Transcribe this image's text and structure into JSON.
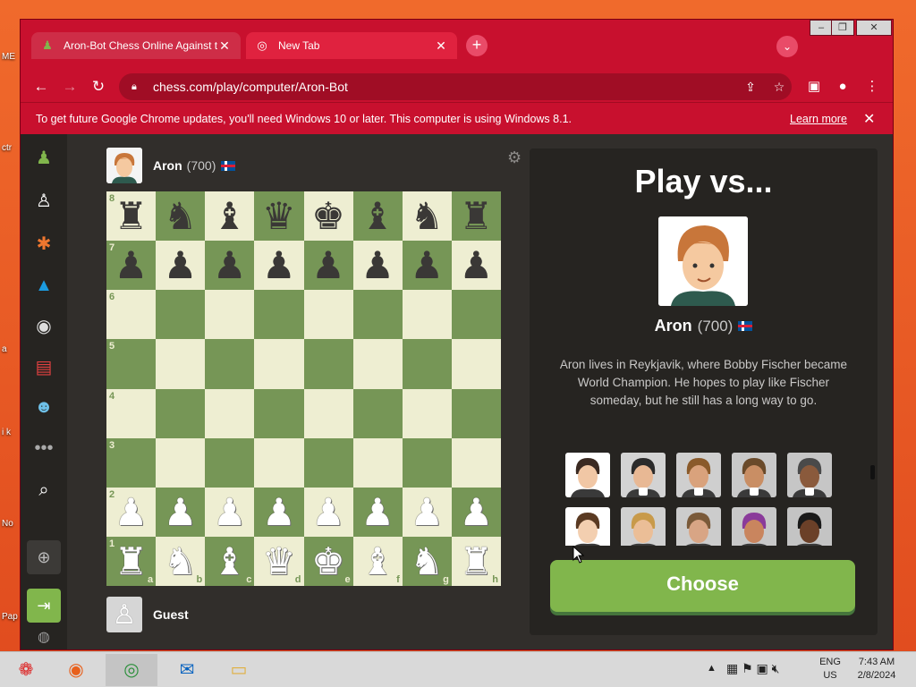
{
  "browser": {
    "tabs": [
      {
        "title": "Aron-Bot Chess Online Against th",
        "active": true
      },
      {
        "title": "New Tab",
        "active": false
      }
    ],
    "url": "chess.com/play/computer/Aron-Bot",
    "infobar": {
      "message": "To get future Google Chrome updates, you'll need Windows 10 or later. This computer is using Windows 8.1.",
      "link": "Learn more"
    },
    "accent": "#c8102e"
  },
  "sidebar": {
    "items": [
      "play-icon",
      "pawn-hand-icon",
      "puzzle-icon",
      "learn-icon",
      "watch-icon",
      "news-icon",
      "social-icon",
      "more-icon",
      "search-icon",
      "add-friend-icon",
      "login-icon",
      "globe-icon",
      "theme-icon"
    ]
  },
  "top_player": {
    "name": "Aron",
    "rating": "(700)"
  },
  "bottom_player": {
    "name": "Guest"
  },
  "board": {
    "rows": [
      [
        "♜",
        "♞",
        "♝",
        "♛",
        "♚",
        "♝",
        "♞",
        "♜"
      ],
      [
        "♟",
        "♟",
        "♟",
        "♟",
        "♟",
        "♟",
        "♟",
        "♟"
      ],
      [
        "",
        "",
        "",
        "",
        "",
        "",
        "",
        ""
      ],
      [
        "",
        "",
        "",
        "",
        "",
        "",
        "",
        ""
      ],
      [
        "",
        "",
        "",
        "",
        "",
        "",
        "",
        ""
      ],
      [
        "",
        "",
        "",
        "",
        "",
        "",
        "",
        ""
      ],
      [
        "♙",
        "♙",
        "♙",
        "♙",
        "♙",
        "♙",
        "♙",
        "♙"
      ],
      [
        "♖",
        "♘",
        "♗",
        "♕",
        "♔",
        "♗",
        "♘",
        "♖"
      ]
    ],
    "ranks": [
      "8",
      "7",
      "6",
      "5",
      "4",
      "3",
      "2",
      "1"
    ],
    "files": [
      "a",
      "b",
      "c",
      "d",
      "e",
      "f",
      "g",
      "h"
    ],
    "light_color": "#eeeed2",
    "dark_color": "#769656"
  },
  "panel": {
    "title": "Play vs...",
    "bot_name": "Aron",
    "bot_rating": "(700)",
    "description": "Aron lives in Reykjavik, where Bobby Fischer became World Champion. He hopes to play like Fischer someday, but he still has a long way to go.",
    "choose_label": "Choose",
    "bots": [
      {
        "locked": false
      },
      {
        "locked": true
      },
      {
        "locked": true
      },
      {
        "locked": true
      },
      {
        "locked": true
      },
      {
        "locked": false
      },
      {
        "locked": false
      },
      {
        "locked": false
      },
      {
        "locked": false
      },
      {
        "locked": false
      }
    ]
  },
  "taskbar": {
    "lang": "ENG",
    "region": "US",
    "time": "7:43 AM",
    "date": "2/8/2024"
  }
}
